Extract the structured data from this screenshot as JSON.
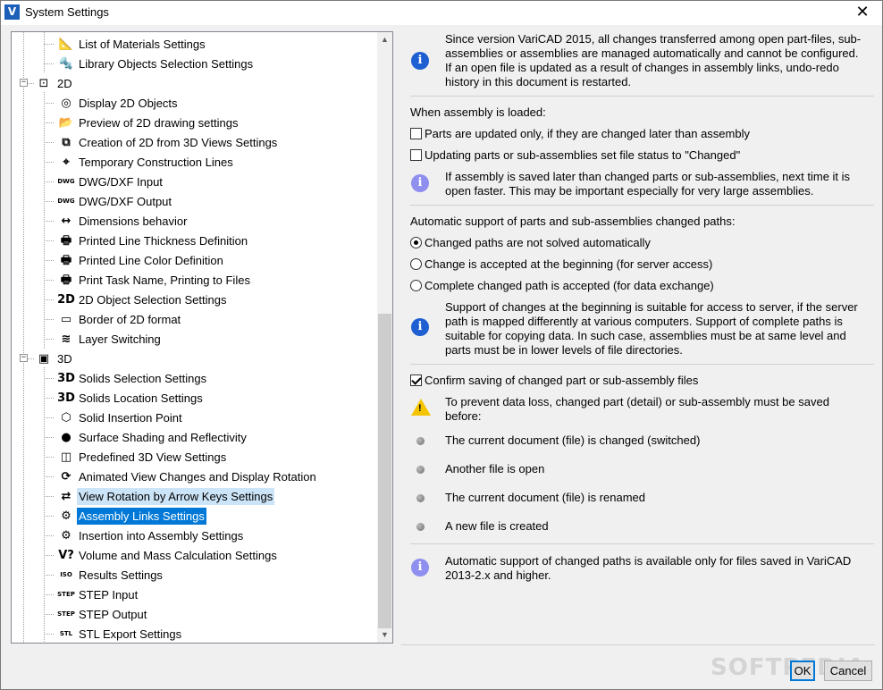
{
  "window": {
    "title": "System Settings",
    "app_icon": "V",
    "close_glyph": "✕"
  },
  "tree": {
    "items": [
      {
        "label": "List of Materials Settings",
        "icon": "materials-icon",
        "glyph": "📐",
        "level": 2
      },
      {
        "label": "Library Objects Selection Settings",
        "icon": "library-icon",
        "glyph": "🔩",
        "level": 2
      },
      {
        "label": "2D",
        "icon": "2d-icon",
        "glyph": "⊡",
        "level": 1,
        "expander": "−"
      },
      {
        "label": "Display 2D Objects",
        "icon": "display-2d-icon",
        "glyph": "◎",
        "level": 2
      },
      {
        "label": "Preview of 2D drawing settings",
        "icon": "folder-check-icon",
        "glyph": "📂",
        "level": 2
      },
      {
        "label": "Creation of 2D from 3D Views Settings",
        "icon": "views-icon",
        "glyph": "⧉",
        "level": 2
      },
      {
        "label": "Temporary Construction Lines",
        "icon": "construction-lines-icon",
        "glyph": "⌖",
        "level": 2
      },
      {
        "label": "DWG/DXF Input",
        "icon": "dwg-input-icon",
        "glyph": "DWG",
        "level": 2
      },
      {
        "label": "DWG/DXF Output",
        "icon": "dwg-output-icon",
        "glyph": "DWG",
        "level": 2
      },
      {
        "label": "Dimensions behavior",
        "icon": "dimension-icon",
        "glyph": "↔",
        "level": 2
      },
      {
        "label": "Printed Line Thickness Definition",
        "icon": "printer-icon",
        "glyph": "🖶",
        "level": 2
      },
      {
        "label": "Printed Line Color Definition",
        "icon": "printer-icon",
        "glyph": "🖶",
        "level": 2
      },
      {
        "label": "Print Task Name, Printing to Files",
        "icon": "printer-icon",
        "glyph": "🖶",
        "level": 2
      },
      {
        "label": "2D Object Selection Settings",
        "icon": "2d-selection-icon",
        "glyph": "2D",
        "level": 2
      },
      {
        "label": "Border of 2D format",
        "icon": "border-icon",
        "glyph": "▭",
        "level": 2
      },
      {
        "label": "Layer Switching",
        "icon": "layers-icon",
        "glyph": "≋",
        "level": 2
      },
      {
        "label": "3D",
        "icon": "3d-icon",
        "glyph": "▣",
        "level": 1,
        "expander": "−"
      },
      {
        "label": "Solids Selection Settings",
        "icon": "solids-selection-icon",
        "glyph": "3D",
        "level": 2
      },
      {
        "label": "Solids Location Settings",
        "icon": "solids-location-icon",
        "glyph": "3D",
        "level": 2
      },
      {
        "label": "Solid Insertion Point",
        "icon": "cube-icon",
        "glyph": "⬡",
        "level": 2
      },
      {
        "label": "Surface Shading and Reflectivity",
        "icon": "sphere-icon",
        "glyph": "●",
        "level": 2
      },
      {
        "label": "Predefined 3D View Settings",
        "icon": "predefined-view-icon",
        "glyph": "◫",
        "level": 2
      },
      {
        "label": "Animated View Changes and Display Rotation",
        "icon": "rotation-icon",
        "glyph": "⟳",
        "level": 2
      },
      {
        "label": "View Rotation by Arrow Keys Settings",
        "icon": "arrow-keys-icon",
        "glyph": "⇄",
        "level": 2,
        "state": "hover"
      },
      {
        "label": "Assembly Links Settings",
        "icon": "assembly-links-icon",
        "glyph": "⚙",
        "level": 2,
        "state": "selected"
      },
      {
        "label": "Insertion into Assembly Settings",
        "icon": "assembly-insert-icon",
        "glyph": "⚙",
        "level": 2
      },
      {
        "label": "Volume and Mass Calculation Settings",
        "icon": "volume-icon",
        "glyph": "V?",
        "level": 2
      },
      {
        "label": "Results Settings",
        "icon": "iso-icon",
        "glyph": "ISO",
        "level": 2
      },
      {
        "label": "STEP Input",
        "icon": "step-input-icon",
        "glyph": "STEP",
        "level": 2
      },
      {
        "label": "STEP Output",
        "icon": "step-output-icon",
        "glyph": "STEP",
        "level": 2
      },
      {
        "label": "STL Export Settings",
        "icon": "stl-icon",
        "glyph": "STL",
        "level": 2
      }
    ],
    "scroll_up": "▲",
    "scroll_down": "▼"
  },
  "panel": {
    "intro": "Since version VariCAD 2015, all changes transferred among open part-files, sub-assemblies or assemblies are managed automatically and cannot be configured. If an open file is updated as a result of changes in assembly links, undo-redo history in this document is restarted.",
    "loaded_heading": "When assembly is loaded:",
    "chk_parts_updated": {
      "label": "Parts are updated only, if they are changed later than assembly",
      "checked": false
    },
    "chk_updating_status": {
      "label": "Updating parts or sub-assemblies set file status to \"Changed\"",
      "checked": false
    },
    "loaded_note": "If assembly is saved later than changed parts or sub-assemblies, next time it is open faster. This may be important especially for very large assemblies.",
    "paths_heading": "Automatic support of parts and sub-assemblies changed paths:",
    "radio_options": [
      {
        "label": "Changed paths are not solved automatically",
        "selected": true
      },
      {
        "label": "Change is accepted at the beginning (for server access)",
        "selected": false
      },
      {
        "label": "Complete changed path is accepted (for data exchange)",
        "selected": false
      }
    ],
    "paths_note": "Support of changes at the beginning is suitable for access to server, if the server path is mapped differently at various computers. Support of complete paths is suitable for copying data. In such case, assemblies must be at same level and parts must be in lower levels of file directories.",
    "chk_confirm_saving": {
      "label": "Confirm saving of changed part or sub-assembly files",
      "checked": true
    },
    "warning": "To prevent data loss, changed part (detail) or sub-assembly must be saved before:",
    "bullets": [
      "The current document (file) is changed (switched)",
      "Another file is open",
      "The current document (file) is renamed",
      "A new file is created"
    ],
    "footer_note": "Automatic support of changed paths is available only for files saved in VariCAD 2013-2.x and higher."
  },
  "buttons": {
    "ok": "OK",
    "cancel": "Cancel"
  },
  "watermark": "SOFTPEDIA",
  "colors": {
    "selection": "#0078d7",
    "hover": "#cce4f7",
    "info": "#1e5fd1",
    "warning": "#f5c400"
  }
}
